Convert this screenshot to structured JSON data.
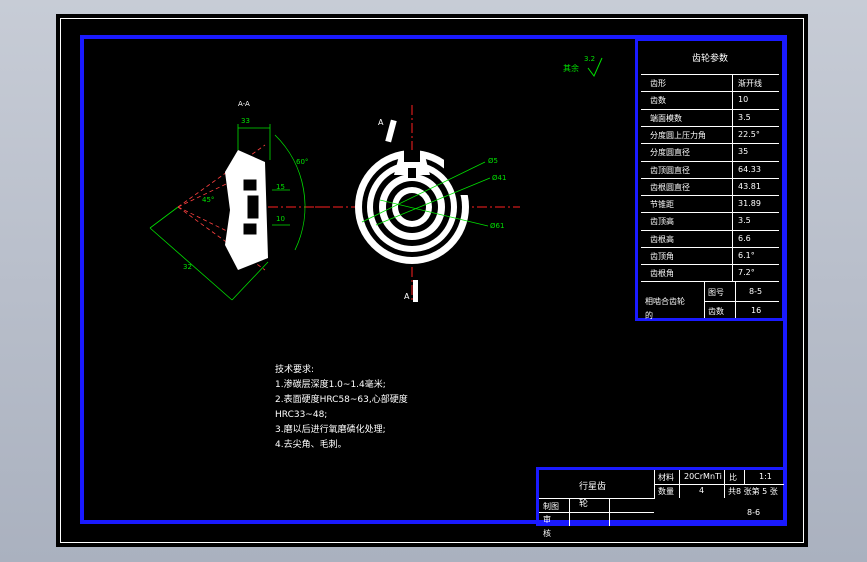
{
  "drawing": {
    "section_label": "A-A",
    "cut_label_top": "A",
    "cut_label_bottom": "A",
    "roughness_note": "其余",
    "roughness_value": "3.2"
  },
  "dims_left": {
    "d_top": "33",
    "d_15": "15",
    "d_10": "10",
    "d_12": "12",
    "d_32": "32",
    "angle1": "60°",
    "angle2": "45°"
  },
  "dims_right": {
    "phi1": "Ø5",
    "phi2": "Ø41",
    "phi3": "Ø61"
  },
  "gear_params": {
    "title": "齿轮参数",
    "rows": [
      {
        "key": "齿形",
        "value": "渐开线"
      },
      {
        "key": "齿数",
        "value": "10"
      },
      {
        "key": "端面模数",
        "value": "3.5"
      },
      {
        "key": "分度圆上压力角",
        "value": "22.5°"
      },
      {
        "key": "分度圆直径",
        "value": "35"
      },
      {
        "key": "齿顶圆直径",
        "value": "64.33"
      },
      {
        "key": "齿根圆直径",
        "value": "43.81"
      },
      {
        "key": "节锥距",
        "value": "31.89"
      },
      {
        "key": "齿顶高",
        "value": "3.5"
      },
      {
        "key": "齿根高",
        "value": "6.6"
      },
      {
        "key": "齿顶角",
        "value": "6.1°"
      },
      {
        "key": "齿根角",
        "value": "7.2°"
      }
    ],
    "mating_label": "相啮合齿轮",
    "mating_sub": "的",
    "mating_rows": [
      {
        "key": "图号",
        "value": "8-5"
      },
      {
        "key": "齿数",
        "value": "16"
      }
    ]
  },
  "tech_notes": {
    "title": "技术要求:",
    "lines": [
      "1.渗碳层深度1.0~1.4毫米;",
      "2.表面硬度HRC58~63,心部硬度",
      "HRC33~48;",
      "3.磨以后进行氧磨磷化处理;",
      "4.去尖角、毛刺。"
    ]
  },
  "title_block": {
    "part_name": "行星齿",
    "part_name2": "轮",
    "material_label": "材料",
    "material": "20CrMnTi",
    "scale_label": "比",
    "scale": "1:1",
    "qty_label": "数量",
    "qty": "4",
    "sheet_label": "共8 张第 5 张",
    "drawn_label": "制图",
    "review_label": "审",
    "check_label": "核",
    "drawing_no": "8-6"
  },
  "colors": {
    "frame_blue": "#1a1aff",
    "dim_green": "#00e000",
    "center_red": "#ff2020",
    "section_red": "#ff4040"
  }
}
